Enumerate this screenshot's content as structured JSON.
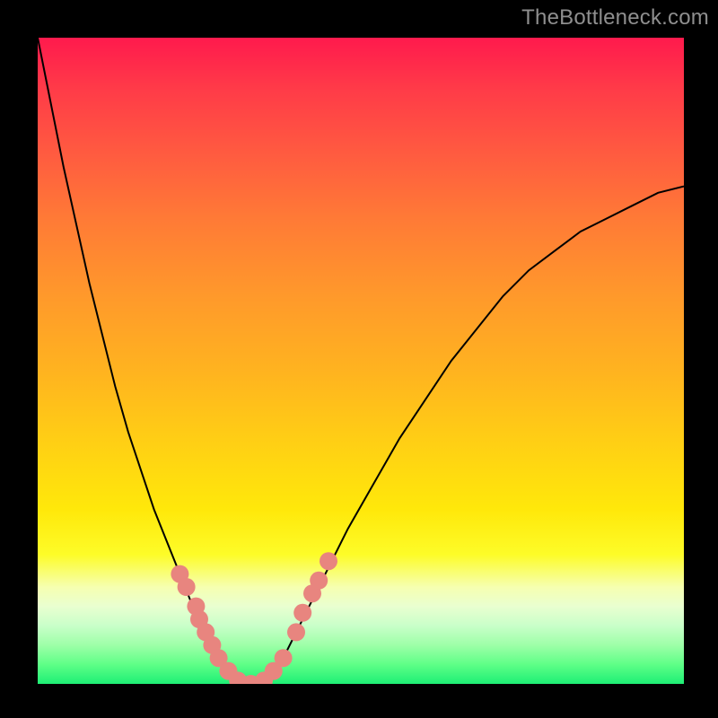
{
  "watermark": {
    "text": "TheBottleneck.com"
  },
  "chart_data": {
    "type": "line",
    "title": "",
    "xlabel": "",
    "ylabel": "",
    "xlim": [
      0,
      100
    ],
    "ylim": [
      0,
      100
    ],
    "grid": false,
    "legend": false,
    "series": [
      {
        "name": "bottleneck-curve",
        "x": [
          0,
          2,
          4,
          6,
          8,
          10,
          12,
          14,
          16,
          18,
          20,
          22,
          24,
          26,
          28,
          30,
          32,
          34,
          36,
          38,
          40,
          44,
          48,
          52,
          56,
          60,
          64,
          68,
          72,
          76,
          80,
          84,
          88,
          92,
          96,
          100
        ],
        "values": [
          100,
          90,
          80,
          71,
          62,
          54,
          46,
          39,
          33,
          27,
          22,
          17,
          12,
          8,
          4,
          1,
          0,
          0,
          1,
          4,
          8,
          16,
          24,
          31,
          38,
          44,
          50,
          55,
          60,
          64,
          67,
          70,
          72,
          74,
          76,
          77
        ],
        "color": "#000000",
        "stroke_width": 2
      }
    ],
    "markers": [
      {
        "name": "highlight-dots",
        "color": "#e8857f",
        "radius": 10,
        "points": [
          {
            "x": 22,
            "y": 17
          },
          {
            "x": 23,
            "y": 15
          },
          {
            "x": 24.5,
            "y": 12
          },
          {
            "x": 25,
            "y": 10
          },
          {
            "x": 26,
            "y": 8
          },
          {
            "x": 27,
            "y": 6
          },
          {
            "x": 28,
            "y": 4
          },
          {
            "x": 29.5,
            "y": 2
          },
          {
            "x": 31,
            "y": 0.5
          },
          {
            "x": 33,
            "y": 0
          },
          {
            "x": 35,
            "y": 0.5
          },
          {
            "x": 36.5,
            "y": 2
          },
          {
            "x": 38,
            "y": 4
          },
          {
            "x": 40,
            "y": 8
          },
          {
            "x": 41,
            "y": 11
          },
          {
            "x": 42.5,
            "y": 14
          },
          {
            "x": 43.5,
            "y": 16
          },
          {
            "x": 45,
            "y": 19
          }
        ]
      }
    ]
  }
}
